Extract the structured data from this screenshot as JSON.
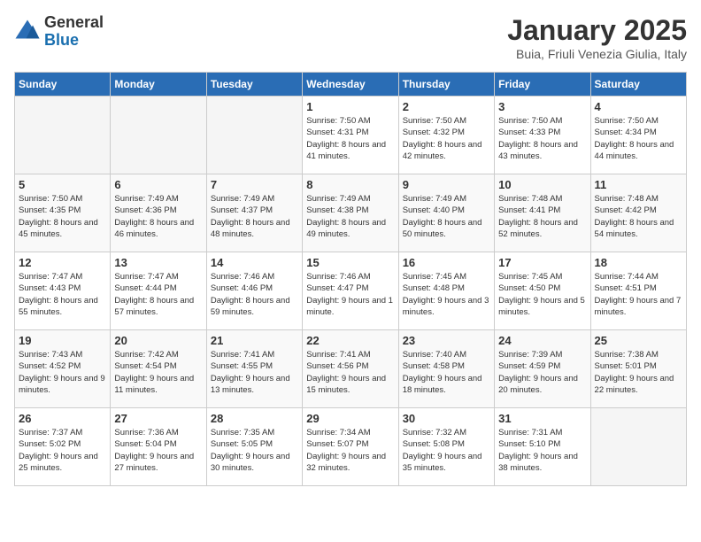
{
  "logo": {
    "general": "General",
    "blue": "Blue"
  },
  "title": "January 2025",
  "subtitle": "Buia, Friuli Venezia Giulia, Italy",
  "days_of_week": [
    "Sunday",
    "Monday",
    "Tuesday",
    "Wednesday",
    "Thursday",
    "Friday",
    "Saturday"
  ],
  "weeks": [
    [
      {
        "day": "",
        "info": ""
      },
      {
        "day": "",
        "info": ""
      },
      {
        "day": "",
        "info": ""
      },
      {
        "day": "1",
        "info": "Sunrise: 7:50 AM\nSunset: 4:31 PM\nDaylight: 8 hours and 41 minutes."
      },
      {
        "day": "2",
        "info": "Sunrise: 7:50 AM\nSunset: 4:32 PM\nDaylight: 8 hours and 42 minutes."
      },
      {
        "day": "3",
        "info": "Sunrise: 7:50 AM\nSunset: 4:33 PM\nDaylight: 8 hours and 43 minutes."
      },
      {
        "day": "4",
        "info": "Sunrise: 7:50 AM\nSunset: 4:34 PM\nDaylight: 8 hours and 44 minutes."
      }
    ],
    [
      {
        "day": "5",
        "info": "Sunrise: 7:50 AM\nSunset: 4:35 PM\nDaylight: 8 hours and 45 minutes."
      },
      {
        "day": "6",
        "info": "Sunrise: 7:49 AM\nSunset: 4:36 PM\nDaylight: 8 hours and 46 minutes."
      },
      {
        "day": "7",
        "info": "Sunrise: 7:49 AM\nSunset: 4:37 PM\nDaylight: 8 hours and 48 minutes."
      },
      {
        "day": "8",
        "info": "Sunrise: 7:49 AM\nSunset: 4:38 PM\nDaylight: 8 hours and 49 minutes."
      },
      {
        "day": "9",
        "info": "Sunrise: 7:49 AM\nSunset: 4:40 PM\nDaylight: 8 hours and 50 minutes."
      },
      {
        "day": "10",
        "info": "Sunrise: 7:48 AM\nSunset: 4:41 PM\nDaylight: 8 hours and 52 minutes."
      },
      {
        "day": "11",
        "info": "Sunrise: 7:48 AM\nSunset: 4:42 PM\nDaylight: 8 hours and 54 minutes."
      }
    ],
    [
      {
        "day": "12",
        "info": "Sunrise: 7:47 AM\nSunset: 4:43 PM\nDaylight: 8 hours and 55 minutes."
      },
      {
        "day": "13",
        "info": "Sunrise: 7:47 AM\nSunset: 4:44 PM\nDaylight: 8 hours and 57 minutes."
      },
      {
        "day": "14",
        "info": "Sunrise: 7:46 AM\nSunset: 4:46 PM\nDaylight: 8 hours and 59 minutes."
      },
      {
        "day": "15",
        "info": "Sunrise: 7:46 AM\nSunset: 4:47 PM\nDaylight: 9 hours and 1 minute."
      },
      {
        "day": "16",
        "info": "Sunrise: 7:45 AM\nSunset: 4:48 PM\nDaylight: 9 hours and 3 minutes."
      },
      {
        "day": "17",
        "info": "Sunrise: 7:45 AM\nSunset: 4:50 PM\nDaylight: 9 hours and 5 minutes."
      },
      {
        "day": "18",
        "info": "Sunrise: 7:44 AM\nSunset: 4:51 PM\nDaylight: 9 hours and 7 minutes."
      }
    ],
    [
      {
        "day": "19",
        "info": "Sunrise: 7:43 AM\nSunset: 4:52 PM\nDaylight: 9 hours and 9 minutes."
      },
      {
        "day": "20",
        "info": "Sunrise: 7:42 AM\nSunset: 4:54 PM\nDaylight: 9 hours and 11 minutes."
      },
      {
        "day": "21",
        "info": "Sunrise: 7:41 AM\nSunset: 4:55 PM\nDaylight: 9 hours and 13 minutes."
      },
      {
        "day": "22",
        "info": "Sunrise: 7:41 AM\nSunset: 4:56 PM\nDaylight: 9 hours and 15 minutes."
      },
      {
        "day": "23",
        "info": "Sunrise: 7:40 AM\nSunset: 4:58 PM\nDaylight: 9 hours and 18 minutes."
      },
      {
        "day": "24",
        "info": "Sunrise: 7:39 AM\nSunset: 4:59 PM\nDaylight: 9 hours and 20 minutes."
      },
      {
        "day": "25",
        "info": "Sunrise: 7:38 AM\nSunset: 5:01 PM\nDaylight: 9 hours and 22 minutes."
      }
    ],
    [
      {
        "day": "26",
        "info": "Sunrise: 7:37 AM\nSunset: 5:02 PM\nDaylight: 9 hours and 25 minutes."
      },
      {
        "day": "27",
        "info": "Sunrise: 7:36 AM\nSunset: 5:04 PM\nDaylight: 9 hours and 27 minutes."
      },
      {
        "day": "28",
        "info": "Sunrise: 7:35 AM\nSunset: 5:05 PM\nDaylight: 9 hours and 30 minutes."
      },
      {
        "day": "29",
        "info": "Sunrise: 7:34 AM\nSunset: 5:07 PM\nDaylight: 9 hours and 32 minutes."
      },
      {
        "day": "30",
        "info": "Sunrise: 7:32 AM\nSunset: 5:08 PM\nDaylight: 9 hours and 35 minutes."
      },
      {
        "day": "31",
        "info": "Sunrise: 7:31 AM\nSunset: 5:10 PM\nDaylight: 9 hours and 38 minutes."
      },
      {
        "day": "",
        "info": ""
      }
    ]
  ]
}
